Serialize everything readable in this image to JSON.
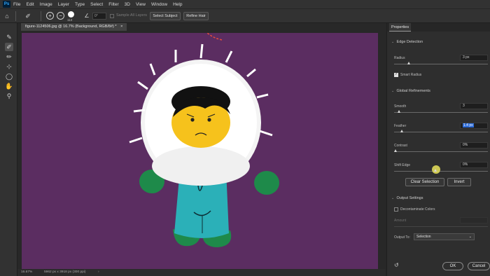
{
  "app": {
    "logo": "Ps"
  },
  "menu": [
    "File",
    "Edit",
    "Image",
    "Layer",
    "Type",
    "Select",
    "Filter",
    "3D",
    "View",
    "Window",
    "Help"
  ],
  "options": {
    "brush_size": "113",
    "angle": "0°",
    "sample_all_layers": "Sample All Layers",
    "select_subject": "Select Subject",
    "refine_hair": "Refine Hair"
  },
  "document": {
    "tab_title": "figure-1124506.jpg @ 16.7% (Background, RGB/8#) *",
    "close_glyph": "×",
    "canvas_color": "#5b2d61"
  },
  "status": {
    "zoom": "16.67%",
    "dimensions": "5962 px x 3918 px (300 ppi)",
    "arrow": "›"
  },
  "properties": {
    "title": "Properties",
    "edge_detection": {
      "heading": "Edge Detection",
      "radius_label": "Radius",
      "radius_value": "3 px",
      "smart_radius_label": "Smart Radius",
      "smart_radius_checked": true
    },
    "global_refinements": {
      "heading": "Global Refinements",
      "smooth_label": "Smooth",
      "smooth_value": "3",
      "feather_label": "Feather",
      "feather_value": "1.4 px",
      "contrast_label": "Contrast",
      "contrast_value": "0%",
      "shift_edge_label": "Shift Edge",
      "shift_edge_value": "0%"
    },
    "clear_selection": "Clear Selection",
    "invert": "Invert",
    "output_settings": {
      "heading": "Output Settings",
      "decontaminate_label": "Decontaminate Colors",
      "amount_label": "Amount",
      "output_to_label": "Output To:",
      "output_to_value": "Selection"
    },
    "ok": "OK",
    "cancel": "Cancel"
  },
  "colors": {
    "accent_highlight": "#2d6bd6",
    "cursor_highlight": "#e8e25a"
  }
}
